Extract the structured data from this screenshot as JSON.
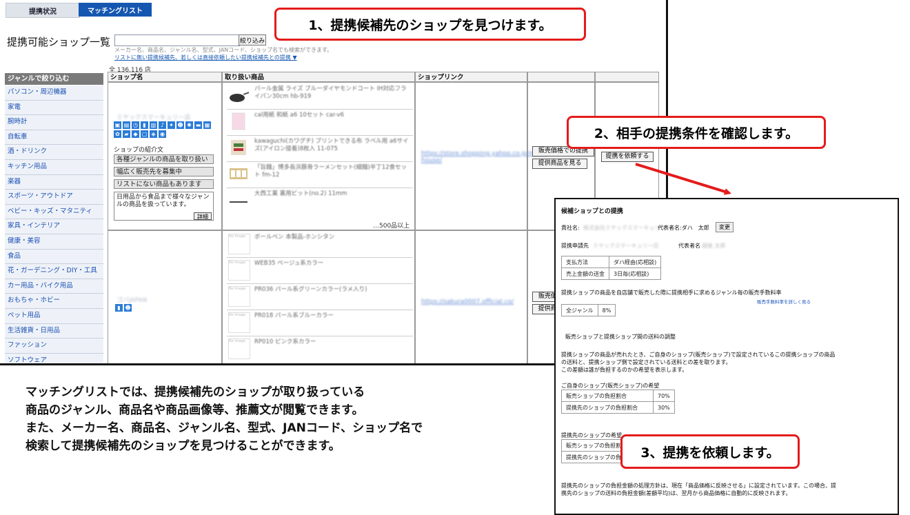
{
  "tabs": {
    "status": "提携状況",
    "matching": "マッチングリスト"
  },
  "page": {
    "heading": "提携可能ショップ一覧",
    "search_button": "絞り込み",
    "search_help": "メーカー名、商品名、ジャンル名、型式、JANコード、ショップ名でも検索ができます。",
    "search_link": "リストに無い提携候補先、若しくは直接依頼したい提携候補先との提携 ▼",
    "total_count": "全 136,116 店"
  },
  "sidebar": {
    "header": "ジャンルで絞り込む",
    "genres": [
      "パソコン・周辺機器",
      "家電",
      "腕時計",
      "自転車",
      "酒・ドリンク",
      "キッチン用品",
      "楽器",
      "スポーツ・アウトドア",
      "ベビー・キッズ・マタニティ",
      "家具・インテリア",
      "健康・美容",
      "食品",
      "花・ガーデニング・DIY・工具",
      "カー用品・バイク用品",
      "おもちゃ・ホビー",
      "ペット用品",
      "生活雑貨・日用品",
      "ファッション",
      "ソフトウェア"
    ]
  },
  "table": {
    "headers": [
      "ショップ名",
      "取り扱い商品",
      "ショップリンク",
      "",
      ""
    ],
    "row1": {
      "shop_name": "ミヤックスマーキュリー店",
      "intro_label": "ショップの紹介文",
      "features": [
        "各種ジャンルの商品を取り扱い",
        "幅広く販売先を募集中",
        "リストにない商品もあります"
      ],
      "description": "日用品から食品まで様々なジャンルの商品を扱っています。",
      "detail_button": "詳細",
      "products": [
        "パール金属 ライズ ブルーダイヤモンドコート IH対応フライパン30cm hb-919",
        "cal用紙 和紙 a6 10セット car-v6",
        "kawaguchi(カワグチ) プリントできる布 ラベル用 a6サイズ(アイロン接着)8枚入 11-075",
        "「旨麺」博多長浜豚骨ラーメンセット(細麺)半丁12食セット fm-12",
        "大西工業 裏用ビット(no.2) 11mm"
      ],
      "more": "…500品以上",
      "link": "https://store.shopping.yahoo.co.jp/mixar-house/",
      "price_button": "販売価格での提携",
      "view_button": "提供商品を見る",
      "request_button": "提携を依頼する"
    },
    "row2": {
      "shop_name": "ゴバJAPAN",
      "products": [
        "ボールペン 本製品-ホンシタン",
        "WEB35 ベージュ系カラー",
        "PR036 パール系グリーンカラー(ラメ入り)",
        "PR018 パール系ブルーカラー",
        "RP010 ピンク系カラー"
      ],
      "no_image": "No Image",
      "link": "https://sakura0007.official.co/",
      "price_button": "販売価格での提携",
      "view_button": "提供商品を見る"
    }
  },
  "callouts": {
    "step1": "1、提携候補先のショップを見つけます。",
    "step2": "2、相手の提携条件を確認します。",
    "step3": "3、提携を依頼します。"
  },
  "explanation": [
    "マッチングリストでは、提携候補先のショップが取り扱っている",
    "商品のジャンル、商品名や商品画像等、推薦文が閲覧できます。",
    "また、メーカー名、商品名、ジャンル名、型式、JANコード、ショップ名で",
    "検索して提携候補先のショップを見つけることができます。"
  ],
  "panel": {
    "title": "候補ショップとの提携",
    "company_label": "貴社名:",
    "company_value": "株式会社ミヤックスマーキュリー",
    "rep_label": "代表者名:ダハ　太郎",
    "change_button": "変更",
    "applicant_label": "提携申請先",
    "applicant_value": "ミヤックスマーキュリー店",
    "applicant_rep_label": "代表者名",
    "applicant_rep_value": "越後 太郎",
    "payment": [
      [
        "支払方法",
        "ダハ経由(応相談)"
      ],
      [
        "売上金額の送金",
        "3日毎(応相談)"
      ]
    ],
    "commission_text": "提携ショップの商品を自店舗で販売した際に提携相手に求めるジャンル毎の販売手数料率",
    "commission_link": "販売手数料率を詳しく見る",
    "commission_table": [
      [
        "全ジャンル",
        "8%"
      ]
    ],
    "shipping_heading": "販売ショップと提携ショップ間の送料の調整",
    "shipping_text": [
      "提携ショップの商品が売れたとき、ご自身のショップ(販売ショップ)で設定されているこの提携ショップの商品",
      "の送料と、提携ショップ側で設定されている送料との差を取ります。",
      "この差額は誰が負担するのかの希望を表示します。"
    ],
    "own_heading": "ご自身のショップ(販売ショップ)の希望",
    "own_table": [
      [
        "販売ショップの負担割合",
        "70%"
      ],
      [
        "提携先のショップの負担割合",
        "30%"
      ]
    ],
    "partner_heading": "提携先のショップの希望",
    "partner_table": [
      [
        "販売ショップの負担割合",
        ""
      ],
      [
        "提携先のショップの負担割合",
        ""
      ]
    ],
    "footer": [
      "提携先のショップの負担金額の処理方針は、現在「商品価格に反映させる」に設定されています。この場合、提",
      "携先のショップの送料の負担金額(差額平均)は、翌月から商品価格に自動的に反映されます。"
    ]
  }
}
